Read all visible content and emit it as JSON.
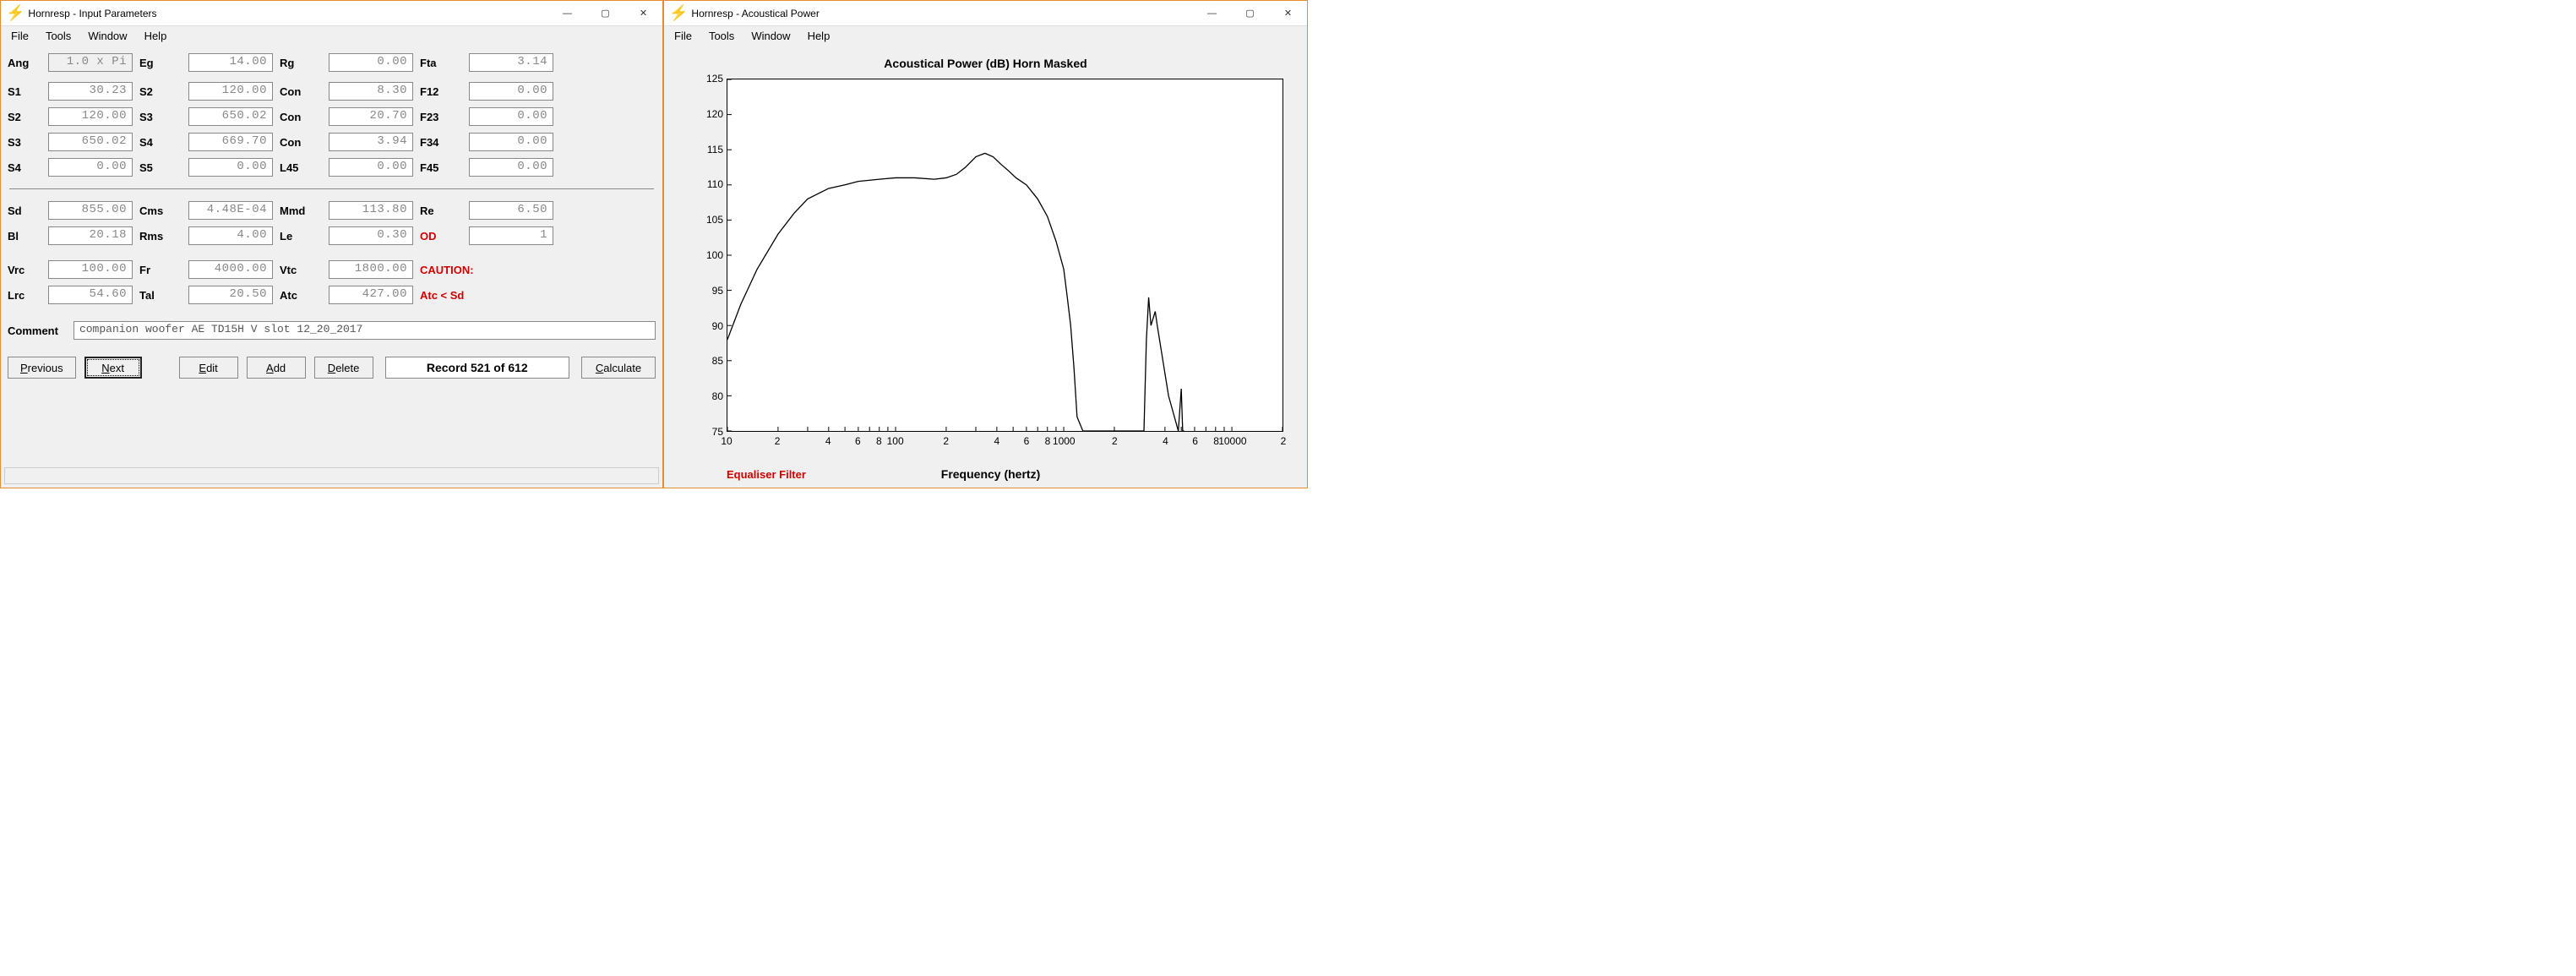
{
  "left_window": {
    "title": "Hornresp - Input Parameters",
    "menu": [
      "File",
      "Tools",
      "Window",
      "Help"
    ],
    "rows_top": [
      [
        {
          "l": "Ang",
          "v": "1.0 x Pi",
          "dim": true
        },
        {
          "l": "Eg",
          "v": "14.00"
        },
        {
          "l": "Rg",
          "v": "0.00"
        },
        {
          "l": "Fta",
          "v": "3.14"
        }
      ],
      [
        {
          "l": "S1",
          "v": "30.23"
        },
        {
          "l": "S2",
          "v": "120.00"
        },
        {
          "l": "Con",
          "v": "8.30"
        },
        {
          "l": "F12",
          "v": "0.00"
        }
      ],
      [
        {
          "l": "S2",
          "v": "120.00"
        },
        {
          "l": "S3",
          "v": "650.02"
        },
        {
          "l": "Con",
          "v": "20.70"
        },
        {
          "l": "F23",
          "v": "0.00"
        }
      ],
      [
        {
          "l": "S3",
          "v": "650.02"
        },
        {
          "l": "S4",
          "v": "669.70"
        },
        {
          "l": "Con",
          "v": "3.94"
        },
        {
          "l": "F34",
          "v": "0.00"
        }
      ],
      [
        {
          "l": "S4",
          "v": "0.00"
        },
        {
          "l": "S5",
          "v": "0.00"
        },
        {
          "l": "L45",
          "v": "0.00"
        },
        {
          "l": "F45",
          "v": "0.00"
        }
      ]
    ],
    "rows_mid": [
      [
        {
          "l": "Sd",
          "v": "855.00"
        },
        {
          "l": "Cms",
          "v": "4.48E-04"
        },
        {
          "l": "Mmd",
          "v": "113.80"
        },
        {
          "l": "Re",
          "v": "6.50"
        }
      ],
      [
        {
          "l": "Bl",
          "v": "20.18"
        },
        {
          "l": "Rms",
          "v": "4.00"
        },
        {
          "l": "Le",
          "v": "0.30"
        },
        {
          "l": "OD",
          "v": "1",
          "red": true
        }
      ]
    ],
    "rows_bot": [
      [
        {
          "l": "Vrc",
          "v": "100.00"
        },
        {
          "l": "Fr",
          "v": "4000.00"
        },
        {
          "l": "Vtc",
          "v": "1800.00"
        },
        {
          "l": "CAUTION:",
          "red": true,
          "novalue": true
        }
      ],
      [
        {
          "l": "Lrc",
          "v": "54.60"
        },
        {
          "l": "Tal",
          "v": "20.50"
        },
        {
          "l": "Atc",
          "v": "427.00"
        },
        {
          "l": "Atc < Sd",
          "red": true,
          "novalue": true
        }
      ]
    ],
    "comment_label": "Comment",
    "comment": "companion woofer  AE TD15H V slot 12_20_2017",
    "buttons": {
      "previous": "Previous",
      "next": "Next",
      "edit": "Edit",
      "add": "Add",
      "delete": "Delete",
      "calculate": "Calculate"
    },
    "record": "Record 521 of 612"
  },
  "right_window": {
    "title": "Hornresp - Acoustical Power",
    "menu": [
      "File",
      "Tools",
      "Window",
      "Help"
    ],
    "chart_title": "Acoustical Power (dB)   Horn   Masked",
    "xlabel": "Frequency (hertz)",
    "eq_label": "Equaliser Filter"
  },
  "chart_data": {
    "type": "line",
    "title": "Acoustical Power (dB)   Horn   Masked",
    "xlabel": "Frequency (hertz)",
    "ylabel": "Acoustical Power (dB)",
    "x_scale": "log",
    "xlim": [
      10,
      20000
    ],
    "ylim": [
      75,
      125
    ],
    "y_ticks": [
      75,
      80,
      85,
      90,
      95,
      100,
      105,
      110,
      115,
      120,
      125
    ],
    "x_ticks": [
      10,
      20,
      40,
      60,
      80,
      100,
      200,
      400,
      600,
      800,
      1000,
      2000,
      4000,
      6000,
      8000,
      10000,
      20000
    ],
    "x_tick_labels": [
      "10",
      "2",
      "4",
      "6",
      "8",
      "100",
      "2",
      "4",
      "6",
      "8",
      "1000",
      "2",
      "4",
      "6",
      "8",
      "10000",
      "2"
    ],
    "series": [
      {
        "name": "Horn Masked",
        "x": [
          10,
          12,
          15,
          20,
          25,
          30,
          40,
          50,
          60,
          80,
          100,
          130,
          170,
          200,
          230,
          260,
          300,
          340,
          380,
          420,
          470,
          520,
          600,
          700,
          800,
          900,
          1000,
          1050,
          1100,
          1150,
          1200,
          1300,
          1600,
          2000,
          3000,
          3100,
          3200,
          3300,
          3400,
          3500,
          3600,
          4200,
          4800,
          5000,
          5100,
          5200
        ],
        "y": [
          88,
          93,
          98,
          103,
          106,
          108,
          109.5,
          110,
          110.5,
          110.8,
          111,
          111,
          110.8,
          111,
          111.5,
          112.5,
          114,
          114.5,
          114,
          113,
          112,
          111,
          110,
          108,
          105.5,
          102,
          98,
          94,
          90,
          84,
          77,
          75,
          75,
          75,
          75,
          88,
          94,
          90,
          91,
          92,
          90,
          80,
          75,
          81,
          75,
          75
        ]
      }
    ]
  }
}
